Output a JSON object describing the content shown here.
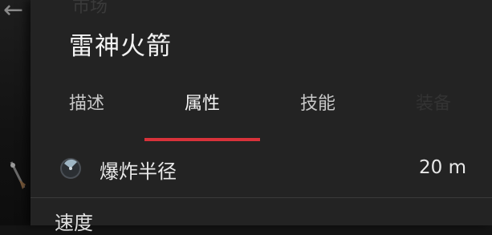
{
  "ghost_header_text": "市场",
  "title": "雷神火箭",
  "tabs": [
    {
      "label": "描述",
      "active": false
    },
    {
      "label": "属性",
      "active": true
    },
    {
      "label": "技能",
      "active": false
    }
  ],
  "ghost_tab_label": "装备",
  "properties": [
    {
      "label": "爆炸半径",
      "value": "20 m",
      "icon": "radar-icon"
    }
  ],
  "next_property_label": "速度",
  "colors": {
    "accent": "#d8323a",
    "panel": "#232323",
    "text": "#e8e8e8"
  }
}
